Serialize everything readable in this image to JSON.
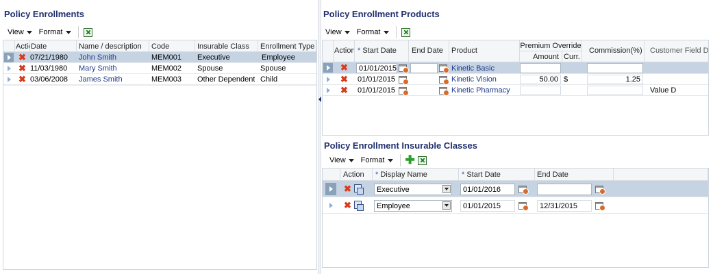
{
  "left_panel": {
    "title": "Policy Enrollments",
    "toolbar": {
      "view_label": "View",
      "format_label": "Format"
    },
    "columns": [
      "Actio",
      "Date",
      "Name / description",
      "Code",
      "Insurable Class",
      "Enrollment Type"
    ],
    "rows": [
      {
        "date": "07/21/1980",
        "name": "John Smith",
        "code": "MEM001",
        "insurable_class": "Executive",
        "enrollment_type": "Employee",
        "selected": true
      },
      {
        "date": "11/03/1980",
        "name": "Mary Smith",
        "code": "MEM002",
        "insurable_class": "Spouse",
        "enrollment_type": "Spouse",
        "selected": false
      },
      {
        "date": "03/06/2008",
        "name": "James Smith",
        "code": "MEM003",
        "insurable_class": "Other Dependent",
        "enrollment_type": "Child",
        "selected": false
      }
    ]
  },
  "products_panel": {
    "title": "Policy Enrollment Products",
    "toolbar": {
      "view_label": "View",
      "format_label": "Format"
    },
    "columns": {
      "action": "Action",
      "start_date": "Start Date",
      "end_date": "End Date",
      "product": "Product",
      "premium_override": "Premium Override",
      "amount": "Amount",
      "curr": "Curr.",
      "commission": "Commission(%)",
      "customer_field": "Customer Field D"
    },
    "required_marker": "*",
    "rows": [
      {
        "start_date": "01/01/2015",
        "end_date": "",
        "product": "Kinetic Basic",
        "amount": "",
        "curr": "",
        "commission": "",
        "customer_field": "",
        "selected": true
      },
      {
        "start_date": "01/01/2015",
        "end_date": "",
        "product": "Kinetic Vision",
        "amount": "50.00",
        "curr": "$",
        "commission": "1.25",
        "customer_field": "",
        "selected": false
      },
      {
        "start_date": "01/01/2015",
        "end_date": "",
        "product": "Kinetic Pharmacy",
        "amount": "",
        "curr": "",
        "commission": "",
        "customer_field": "Value D",
        "selected": false
      }
    ]
  },
  "classes_panel": {
    "title": "Policy Enrollment Insurable Classes",
    "toolbar": {
      "view_label": "View",
      "format_label": "Format"
    },
    "columns": {
      "action": "Action",
      "display_name": "Display Name",
      "start_date": "Start Date",
      "end_date": "End Date"
    },
    "required_marker": "*",
    "rows": [
      {
        "display_name": "Executive",
        "start_date": "01/01/2016",
        "end_date": "",
        "selected": true
      },
      {
        "display_name": "Employee",
        "start_date": "01/01/2015",
        "end_date": "12/31/2015",
        "selected": false
      }
    ]
  },
  "icons": {
    "delete": "delete-x-icon",
    "calendar": "calendar-icon",
    "export": "excel-export-icon",
    "add": "add-plus-icon",
    "copy": "copy-record-icon",
    "row_selector": "row-selector-arrow-icon"
  },
  "colors": {
    "title": "#1f2f6e",
    "link": "#1f3a88",
    "selected_row": "#c5d3e2",
    "delete": "#d93a1a",
    "add": "#2a9d2a"
  }
}
